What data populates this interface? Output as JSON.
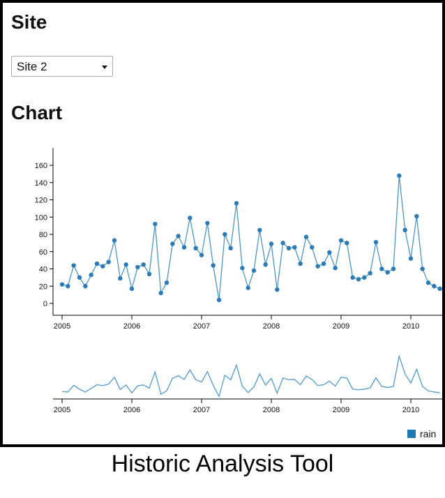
{
  "site_section": {
    "heading": "Site",
    "select_value": "Site 2"
  },
  "chart_section": {
    "heading": "Chart"
  },
  "legend": {
    "label": "rain",
    "color": "#1f77b4"
  },
  "caption": "Historic Analysis Tool",
  "chart_data": {
    "type": "line",
    "x_axis_type": "date",
    "x_start": "2005-01",
    "x_step": "month",
    "x_tick_labels": [
      "2005",
      "2006",
      "2007",
      "2008",
      "2009",
      "2010"
    ],
    "y_tick_labels": [
      "0",
      "20",
      "40",
      "60",
      "80",
      "100",
      "120",
      "140",
      "160"
    ],
    "ylim": [
      -10,
      180
    ],
    "series": [
      {
        "name": "rain",
        "color": "#4a96c8",
        "values": [
          22,
          20,
          44,
          30,
          20,
          33,
          46,
          43,
          48,
          73,
          29,
          45,
          17,
          42,
          45,
          34,
          92,
          12,
          24,
          69,
          78,
          65,
          99,
          64,
          56,
          93,
          44,
          4,
          80,
          64,
          116,
          41,
          18,
          38,
          85,
          45,
          69,
          16,
          70,
          64,
          65,
          46,
          77,
          65,
          43,
          46,
          59,
          41,
          73,
          70,
          30,
          28,
          30,
          35,
          71,
          40,
          36,
          40,
          148,
          85,
          52,
          101,
          40,
          24,
          20,
          17
        ]
      }
    ],
    "context_view": {
      "shown": true,
      "series": "rain",
      "x_tick_labels": [
        "2005",
        "2006",
        "2007",
        "2008",
        "2009",
        "2010"
      ]
    }
  }
}
